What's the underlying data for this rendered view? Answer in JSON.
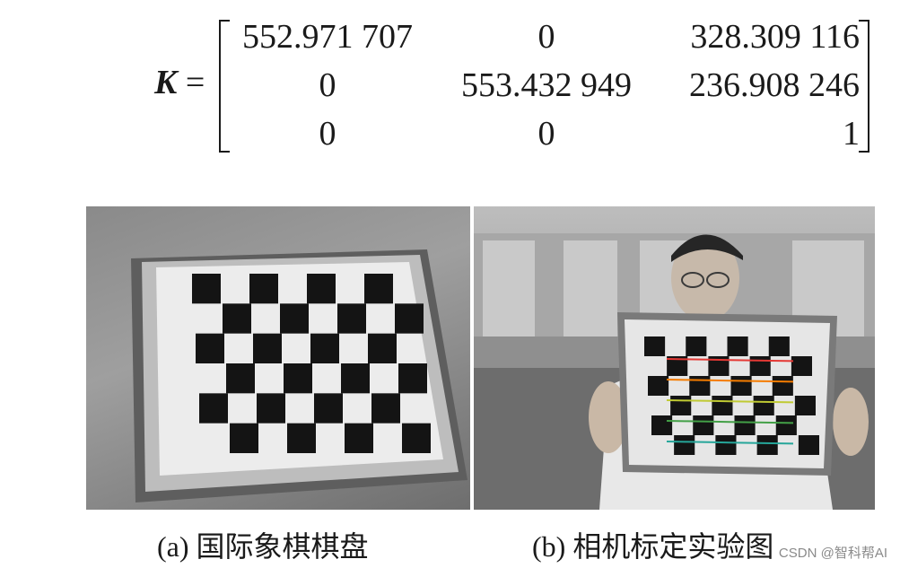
{
  "equation": {
    "lhs_symbol": "K",
    "equals": "=",
    "matrix": [
      [
        "552.971 707",
        "0",
        "328.309 116"
      ],
      [
        "0",
        "553.432 949",
        "236.908 246"
      ],
      [
        "0",
        "0",
        "1"
      ]
    ]
  },
  "figures": [
    {
      "caption": "(a) 国际象棋棋盘"
    },
    {
      "caption": "(b) 相机标定实验图"
    }
  ],
  "watermark": "CSDN @智科帮AI"
}
